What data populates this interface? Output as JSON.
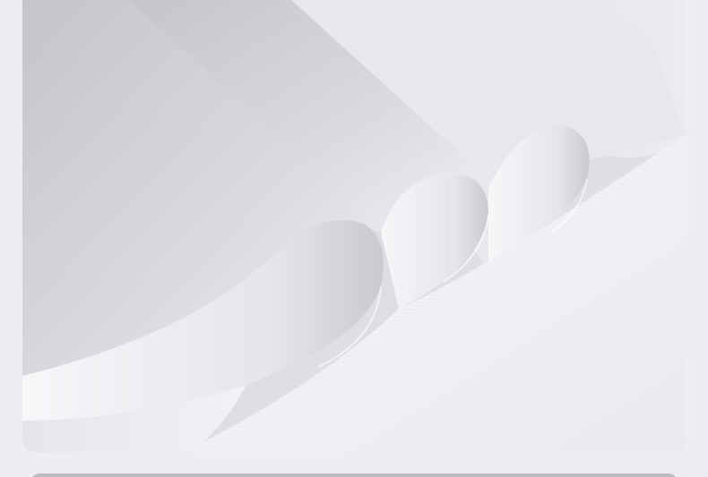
{
  "photo": {
    "subject": "product-photo-of-curled-white-paper-sheets",
    "colors": {
      "paper_light": "#f4f5f8",
      "paper_mid": "#dcdee3",
      "paper_shadow": "#b8bac0",
      "corner_accent": "#2f4a38"
    }
  }
}
